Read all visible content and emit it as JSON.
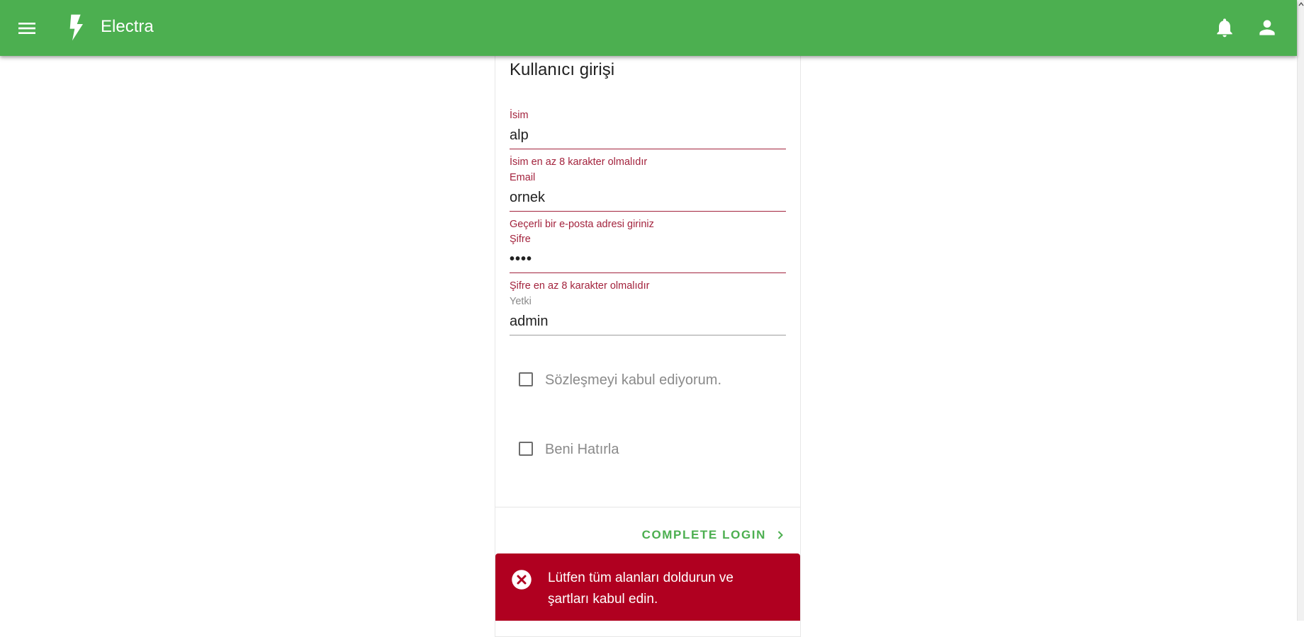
{
  "app": {
    "title": "Electra",
    "icons": {
      "menu": "menu-icon",
      "brand": "lightning-bolt-icon",
      "notifications": "bell-icon",
      "account": "account-icon"
    },
    "colors": {
      "primary": "#4caf50",
      "error": "#a3233d",
      "snackbar": "#b00020"
    }
  },
  "form": {
    "title": "Kullanıcı girişi",
    "fields": [
      {
        "label": "İsim",
        "value": "alp",
        "error": "İsim en az 8 karakter olmalıdır"
      },
      {
        "label": "Email",
        "value": "ornek",
        "error": "Geçerli bir e-posta adresi giriniz"
      },
      {
        "label": "Şifre",
        "value": "••••",
        "error": "Şifre en az 8 karakter olmalıdır"
      },
      {
        "label": "Yetki",
        "value": "admin",
        "error": ""
      }
    ],
    "checkboxes": [
      {
        "label": "Sözleşmeyi kabul ediyorum.",
        "checked": false
      },
      {
        "label": "Beni Hatırla",
        "checked": false
      }
    ],
    "submit_label": "COMPLETE LOGIN"
  },
  "snackbar": {
    "icon": "error-circle-icon",
    "message": "Lütfen tüm alanları doldurun ve şartları kabul edin."
  }
}
